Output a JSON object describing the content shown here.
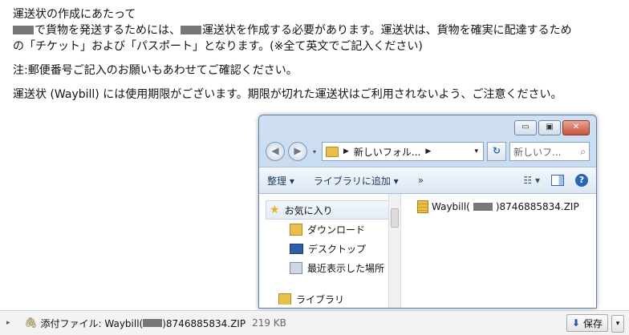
{
  "email": {
    "line1": "運送状の作成にあたって",
    "line2_a": "で貨物を発送するためには、",
    "line2_b": "運送状を作成する必要があります。運送状は、貨物を確実に配達するため",
    "line3": "の「チケット」および「パスポート」となります。(※全て英文でご記入ください)",
    "note": "注:郵便番号ご記入のお願いもあわせてご確認ください。",
    "warning": "運送状 (Waybill) には使用期限がございます。期限が切れた運送状はご利用されないよう、ご注意ください。"
  },
  "explorer": {
    "window_buttons": {
      "minimize": "▭",
      "maximize": "▣",
      "close": "✕"
    },
    "address": {
      "path": "新しいフォル...",
      "search_placeholder": "新しいフ..."
    },
    "toolbar": {
      "organize": "整理 ▾",
      "add_to_library": "ライブラリに追加 ▾",
      "more": "»"
    },
    "nav": {
      "favorites": "お気に入り",
      "downloads": "ダウンロード",
      "desktop": "デスクトップ",
      "recent": "最近表示した場所",
      "libraries": "ライブラリ"
    },
    "file": {
      "name_prefix": "Waybill(",
      "name_suffix": ")8746885834.ZIP"
    }
  },
  "attachment": {
    "label_prefix": "添付ファイル: Waybill(",
    "label_suffix": ")8746885834.ZIP",
    "size": "219 KB",
    "save_label": "保存"
  }
}
